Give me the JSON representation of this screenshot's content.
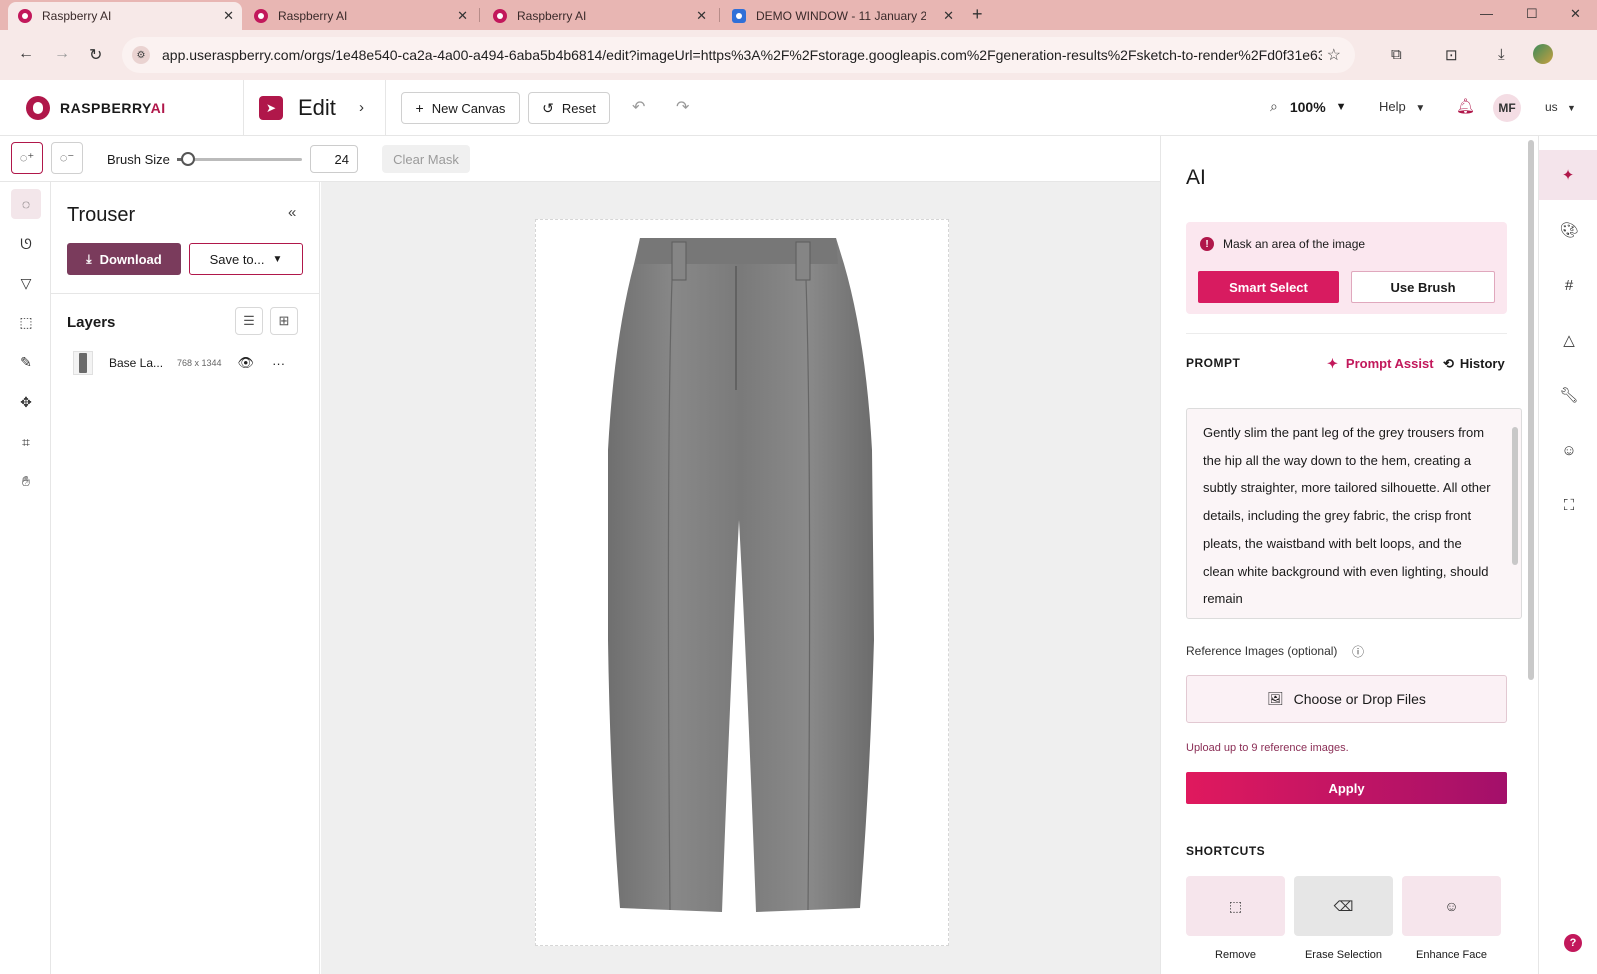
{
  "browser": {
    "tabs": [
      {
        "title": "Raspberry AI",
        "active": true
      },
      {
        "title": "Raspberry AI",
        "active": false
      },
      {
        "title": "Raspberry AI",
        "active": false
      },
      {
        "title": "DEMO WINDOW - 11 January 2",
        "active": false
      }
    ],
    "url": "app.useraspberry.com/orgs/1e48e540-ca2a-4a00-a494-6aba5b4b6814/edit?imageUrl=https%3A%2F%2Fstorage.googleapis.com%2Fgeneration-results%2Fsketch-to-render%2Fd0f31e63-..."
  },
  "app": {
    "logo_main": "RASPBERRY",
    "logo_ai": "AI",
    "mode_title": "Edit",
    "new_canvas_label": "New Canvas",
    "reset_label": "Reset",
    "zoom_value": "100%",
    "help_label": "Help",
    "user_initials": "MF",
    "locale": "us"
  },
  "tool_options": {
    "brush_size_label": "Brush Size",
    "brush_size_value": "24",
    "brush_size_fraction": 0.05,
    "clear_mask_label": "Clear Mask"
  },
  "layers_panel": {
    "project_title": "Trouser",
    "download_label": "Download",
    "save_to_label": "Save to...",
    "layers_heading": "Layers",
    "layers": [
      {
        "name": "Base La...",
        "size": "768 x 1344"
      }
    ]
  },
  "ai_panel": {
    "title": "AI",
    "mask_message": "Mask an area of the image",
    "smart_select_label": "Smart Select",
    "use_brush_label": "Use Brush",
    "prompt_heading": "PROMPT",
    "prompt_assist_label": "Prompt Assist",
    "history_label": "History",
    "prompt_text": "Gently slim the pant leg of the grey trousers from the hip all the way down to the hem, creating a subtly straighter, more tailored silhouette. All other details, including the grey fabric, the crisp front pleats, the waistband with belt loops, and the clean white background with even lighting, should remain",
    "reference_label": "Reference Images (optional)",
    "choose_files_label": "Choose or Drop Files",
    "upload_note": "Upload up to 9 reference images.",
    "apply_label": "Apply",
    "shortcuts_heading": "SHORTCUTS",
    "shortcuts": [
      {
        "label": "Remove",
        "icon": "dashed-square-icon"
      },
      {
        "label": "Erase Selection",
        "icon": "eraser-icon"
      },
      {
        "label": "Enhance Face",
        "icon": "face-sparkle-icon"
      }
    ]
  },
  "colors": {
    "brand": "#b0174a",
    "accent": "#d81b60",
    "chrome": "#e8b6b3"
  }
}
